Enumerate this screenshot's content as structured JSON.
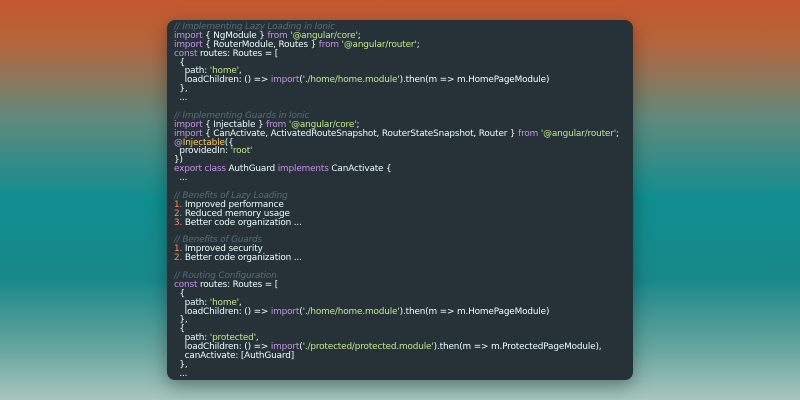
{
  "editor": {
    "lines": [
      [
        {
          "t": "// Implementing Lazy Loading in Ionic",
          "c": "c"
        }
      ],
      [
        {
          "t": "import",
          "c": "k"
        },
        {
          "t": " { NgModule } ",
          "c": "t"
        },
        {
          "t": "from",
          "c": "k"
        },
        {
          "t": " ",
          "c": "t"
        },
        {
          "t": "'@angular/core'",
          "c": "s"
        },
        {
          "t": ";",
          "c": "t"
        }
      ],
      [
        {
          "t": "import",
          "c": "k"
        },
        {
          "t": " { RouterModule, Routes } ",
          "c": "t"
        },
        {
          "t": "from",
          "c": "k"
        },
        {
          "t": " ",
          "c": "t"
        },
        {
          "t": "'@angular/router'",
          "c": "s"
        },
        {
          "t": ";",
          "c": "t"
        }
      ],
      [
        {
          "t": "const",
          "c": "k"
        },
        {
          "t": " routes: Routes = [",
          "c": "t"
        }
      ],
      [
        {
          "t": "  {",
          "c": "t"
        }
      ],
      [
        {
          "t": "    path: ",
          "c": "t"
        },
        {
          "t": "'home'",
          "c": "s"
        },
        {
          "t": ",",
          "c": "t"
        }
      ],
      [
        {
          "t": "    loadChildren: () => ",
          "c": "t"
        },
        {
          "t": "import",
          "c": "k"
        },
        {
          "t": "(",
          "c": "t"
        },
        {
          "t": "'./home/home.module'",
          "c": "s"
        },
        {
          "t": ").then(m => m.HomePageModule)",
          "c": "t"
        }
      ],
      [
        {
          "t": "  },",
          "c": "t"
        }
      ],
      [
        {
          "t": "  ...",
          "c": "t"
        }
      ],
      [],
      [
        {
          "t": "// Implementing Guards in Ionic",
          "c": "c"
        }
      ],
      [
        {
          "t": "import",
          "c": "k"
        },
        {
          "t": " { Injectable } ",
          "c": "t"
        },
        {
          "t": "from",
          "c": "k"
        },
        {
          "t": " ",
          "c": "t"
        },
        {
          "t": "'@angular/core'",
          "c": "s"
        },
        {
          "t": ";",
          "c": "t"
        }
      ],
      [
        {
          "t": "import",
          "c": "k"
        },
        {
          "t": " { CanActivate, ActivatedRouteSnapshot, RouterStateSnapshot, Router } ",
          "c": "t"
        },
        {
          "t": "from",
          "c": "k"
        },
        {
          "t": " ",
          "c": "t"
        },
        {
          "t": "'@angular/router'",
          "c": "s"
        },
        {
          "t": ";",
          "c": "t"
        }
      ],
      [
        {
          "t": "@",
          "c": "k"
        },
        {
          "t": "Injectable",
          "c": "d"
        },
        {
          "t": "({",
          "c": "t"
        }
      ],
      [
        {
          "t": "  providedIn: ",
          "c": "t"
        },
        {
          "t": "'root'",
          "c": "s"
        }
      ],
      [
        {
          "t": "})",
          "c": "t"
        }
      ],
      [
        {
          "t": "export",
          "c": "k"
        },
        {
          "t": " ",
          "c": "t"
        },
        {
          "t": "class",
          "c": "k"
        },
        {
          "t": " AuthGuard ",
          "c": "t"
        },
        {
          "t": "implements",
          "c": "k"
        },
        {
          "t": " CanActivate {",
          "c": "t"
        }
      ],
      [
        {
          "t": "  ...",
          "c": "t"
        }
      ],
      [],
      [
        {
          "t": "// Benefits of Lazy Loading",
          "c": "c"
        }
      ],
      [
        {
          "t": "1.",
          "c": "n"
        },
        {
          "t": " Improved performance",
          "c": "t"
        }
      ],
      [
        {
          "t": "2.",
          "c": "n"
        },
        {
          "t": " Reduced memory usage",
          "c": "t"
        }
      ],
      [
        {
          "t": "3.",
          "c": "n"
        },
        {
          "t": " Better code organization ...",
          "c": "t"
        }
      ],
      [],
      [
        {
          "t": "// Benefits of Guards",
          "c": "c"
        }
      ],
      [
        {
          "t": "1.",
          "c": "n"
        },
        {
          "t": " Improved security",
          "c": "t"
        }
      ],
      [
        {
          "t": "2.",
          "c": "n"
        },
        {
          "t": " Better code organization ...",
          "c": "t"
        }
      ],
      [],
      [
        {
          "t": "// Routing Configuration",
          "c": "c"
        }
      ],
      [
        {
          "t": "const",
          "c": "k"
        },
        {
          "t": " routes: Routes = [",
          "c": "t"
        }
      ],
      [
        {
          "t": "  {",
          "c": "t"
        }
      ],
      [
        {
          "t": "    path: ",
          "c": "t"
        },
        {
          "t": "'home'",
          "c": "s"
        },
        {
          "t": ",",
          "c": "t"
        }
      ],
      [
        {
          "t": "    loadChildren: () => ",
          "c": "t"
        },
        {
          "t": "import",
          "c": "k"
        },
        {
          "t": "(",
          "c": "t"
        },
        {
          "t": "'./home/home.module'",
          "c": "s"
        },
        {
          "t": ").then(m => m.HomePageModule)",
          "c": "t"
        }
      ],
      [
        {
          "t": "  },",
          "c": "t"
        }
      ],
      [
        {
          "t": "  {",
          "c": "t"
        }
      ],
      [
        {
          "t": "    path: ",
          "c": "t"
        },
        {
          "t": "'protected'",
          "c": "s"
        },
        {
          "t": ",",
          "c": "t"
        }
      ],
      [
        {
          "t": "    loadChildren: () => ",
          "c": "t"
        },
        {
          "t": "import",
          "c": "k"
        },
        {
          "t": "(",
          "c": "t"
        },
        {
          "t": "'./protected/protected.module'",
          "c": "s"
        },
        {
          "t": ").then(m => m.ProtectedPageModule),",
          "c": "t"
        }
      ],
      [
        {
          "t": "    canActivate: [AuthGuard]",
          "c": "t"
        }
      ],
      [
        {
          "t": "  },",
          "c": "t"
        }
      ],
      [
        {
          "t": "  ...",
          "c": "t"
        }
      ]
    ]
  }
}
